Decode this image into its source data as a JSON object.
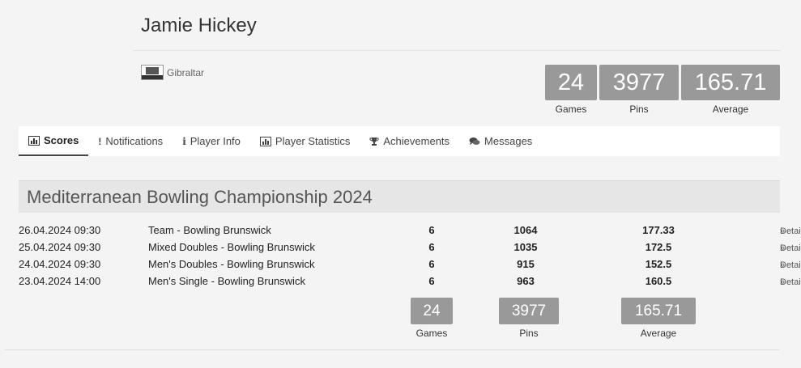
{
  "player": {
    "name": "Jamie Hickey",
    "country": "Gibraltar"
  },
  "stats": [
    {
      "value": "24",
      "label": "Games"
    },
    {
      "value": "3977",
      "label": "Pins"
    },
    {
      "value": "165.71",
      "label": "Average"
    }
  ],
  "tabs": [
    {
      "label": "Scores",
      "icon": "bar-chart-icon",
      "active": true
    },
    {
      "label": "Notifications",
      "icon": "exclamation-icon"
    },
    {
      "label": "Player Info",
      "icon": "info-icon"
    },
    {
      "label": "Player Statistics",
      "icon": "bar-chart-icon"
    },
    {
      "label": "Achievements",
      "icon": "trophy-icon"
    },
    {
      "label": "Messages",
      "icon": "comments-icon"
    }
  ],
  "championship": {
    "title": "Mediterranean Bowling Championship 2024",
    "rows": [
      {
        "date": "26.04.2024 09:30",
        "event": "Team - Bowling Brunswick",
        "games": "6",
        "pins": "1064",
        "average": "177.33",
        "details": "Details"
      },
      {
        "date": "25.04.2024 09:30",
        "event": "Mixed Doubles - Bowling Brunswick",
        "games": "6",
        "pins": "1035",
        "average": "172.5",
        "details": "Details"
      },
      {
        "date": "24.04.2024 09:30",
        "event": "Men's Doubles - Bowling Brunswick",
        "games": "6",
        "pins": "915",
        "average": "152.5",
        "details": "Details"
      },
      {
        "date": "23.04.2024 14:00",
        "event": "Men's Single - Bowling Brunswick",
        "games": "6",
        "pins": "963",
        "average": "160.5",
        "details": "Details"
      }
    ],
    "totals": [
      {
        "value": "24",
        "label": "Games"
      },
      {
        "value": "3977",
        "label": "Pins"
      },
      {
        "value": "165.71",
        "label": "Average"
      }
    ]
  }
}
